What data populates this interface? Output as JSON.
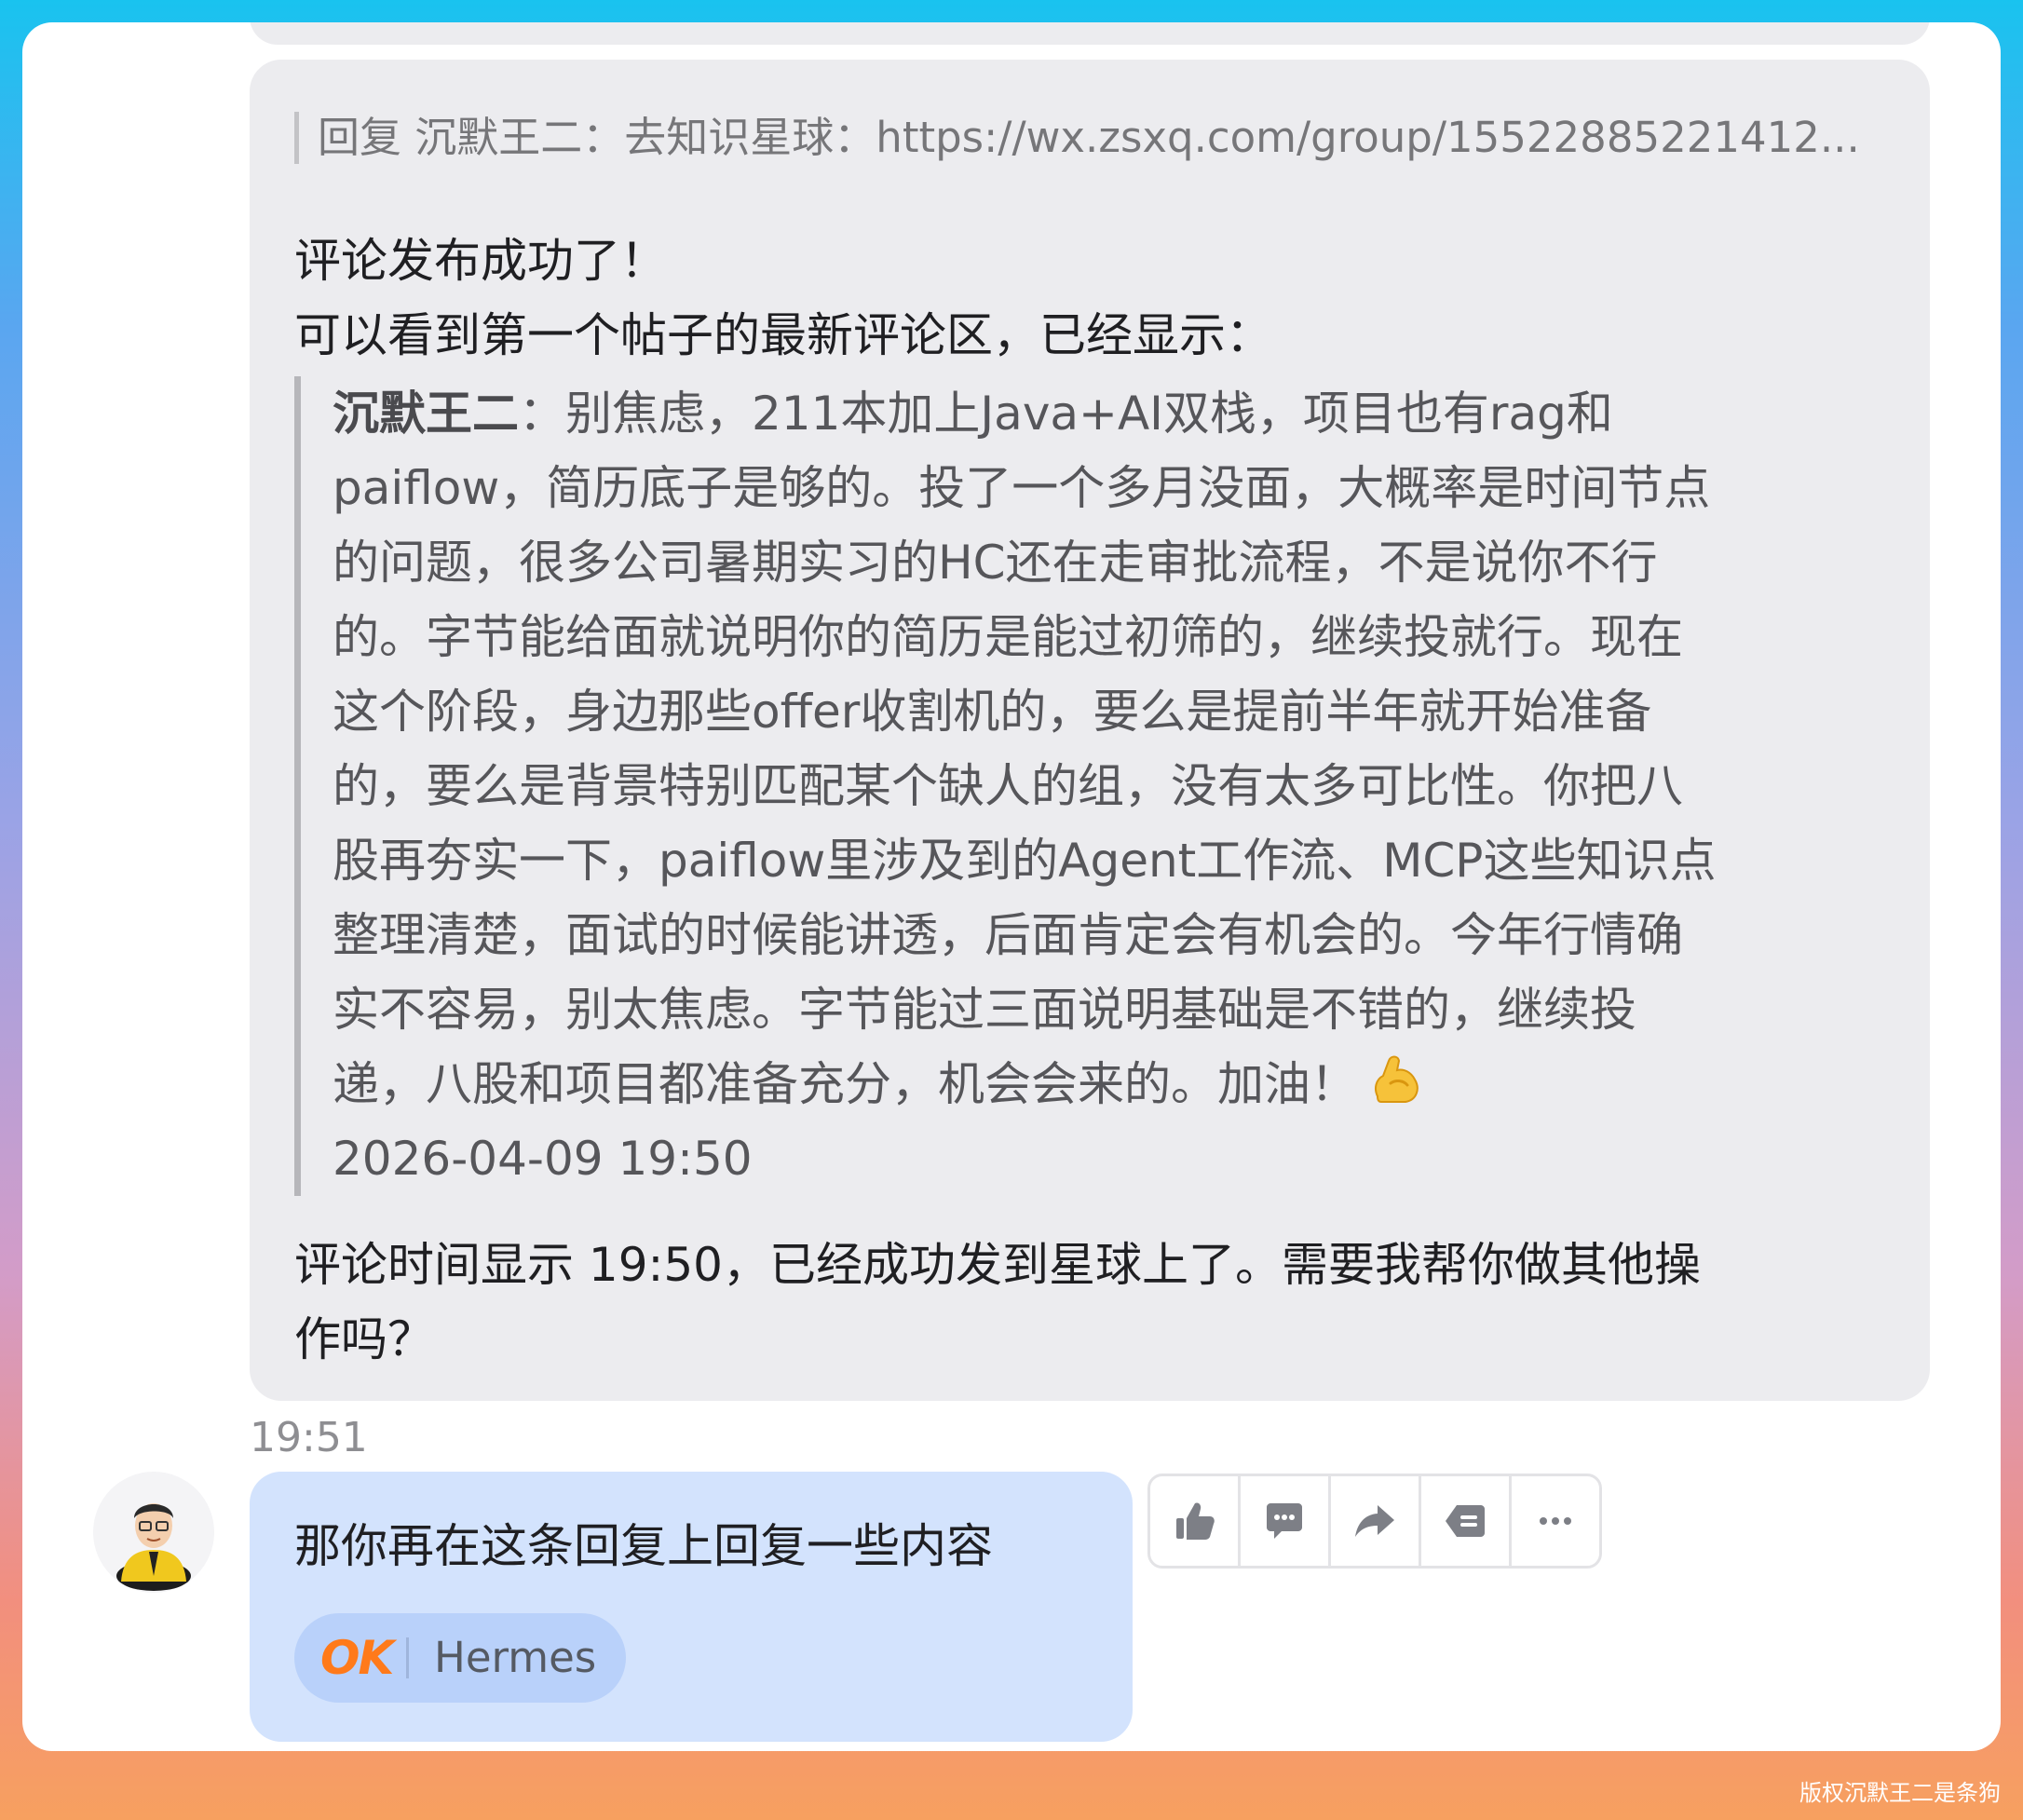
{
  "ai_message": {
    "reply_reference": "回复 沉默王二：去知识星球：https://wx.zsxq.com/group/15522885221412...",
    "line1": "评论发布成功了！",
    "line2": "可以看到第一个帖子的最新评论区，已经显示：",
    "quote": {
      "author": "沉默王二",
      "line1": "：别焦虑，211本加上Java+AI双栈，项目也有rag和",
      "line2": "paiflow，简历底子是够的。投了一个多月没面，大概率是时间节点",
      "line3": "的问题，很多公司暑期实习的HC还在走审批流程，不是说你不行",
      "line4": "的。字节能给面就说明你的简历是能过初筛的，继续投就行。现在",
      "line5": "这个阶段，身边那些offer收割机的，要么是提前半年就开始准备",
      "line6": "的，要么是背景特别匹配某个缺人的组，没有太多可比性。你把八",
      "line7": "股再夯实一下，paiflow里涉及到的Agent工作流、MCP这些知识点",
      "line8": "整理清楚，面试的时候能讲透，后面肯定会有机会的。今年行情确",
      "line9": "实不容易，别太焦虑。字节能过三面说明基础是不错的，继续投",
      "line10": "递，八股和项目都准备充分，机会会来的。加油！",
      "timestamp": "2026-04-09 19:50"
    },
    "line3": "评论时间显示 19:50，已经成功发到星球上了。需要我帮你做其他操",
    "line4": "作吗？"
  },
  "time_label": "19:51",
  "user_message": {
    "text": "那你再在这条回复上回复一些内容",
    "tag_badge": "OK",
    "tag_name": "Hermes"
  },
  "actions": [
    "thumbs-up-icon",
    "comment-icon",
    "share-icon",
    "quote-icon",
    "more-icon"
  ],
  "watermark": "版权沉默王二是条狗"
}
